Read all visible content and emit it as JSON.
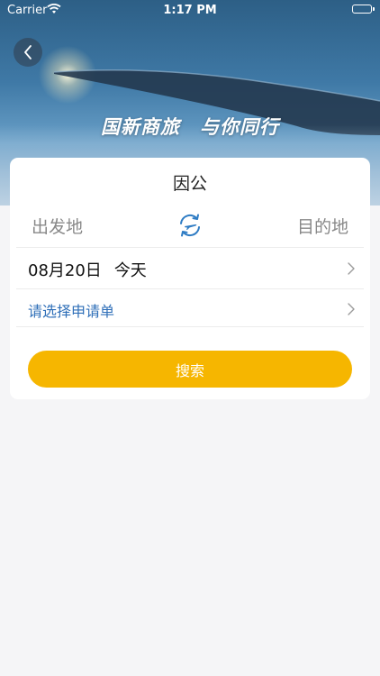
{
  "status_bar": {
    "carrier": "Carrier",
    "time": "1:17 PM"
  },
  "hero": {
    "slogan_left": "国新商旅",
    "slogan_right": "与你同行"
  },
  "card": {
    "title": "因公",
    "origin_placeholder": "出发地",
    "destination_placeholder": "目的地",
    "date": "08月20日",
    "date_note": "今天",
    "application_prompt": "请选择申请单",
    "search_label": "搜索"
  },
  "colors": {
    "accent_yellow": "#f6b600",
    "link_blue": "#2f6fb8",
    "swap_icon_blue": "#2f7cc4",
    "background": "#f5f5f7"
  },
  "icons": [
    "back-icon",
    "wifi-icon",
    "battery-icon",
    "swap-route-icon",
    "chevron-right-icon"
  ]
}
